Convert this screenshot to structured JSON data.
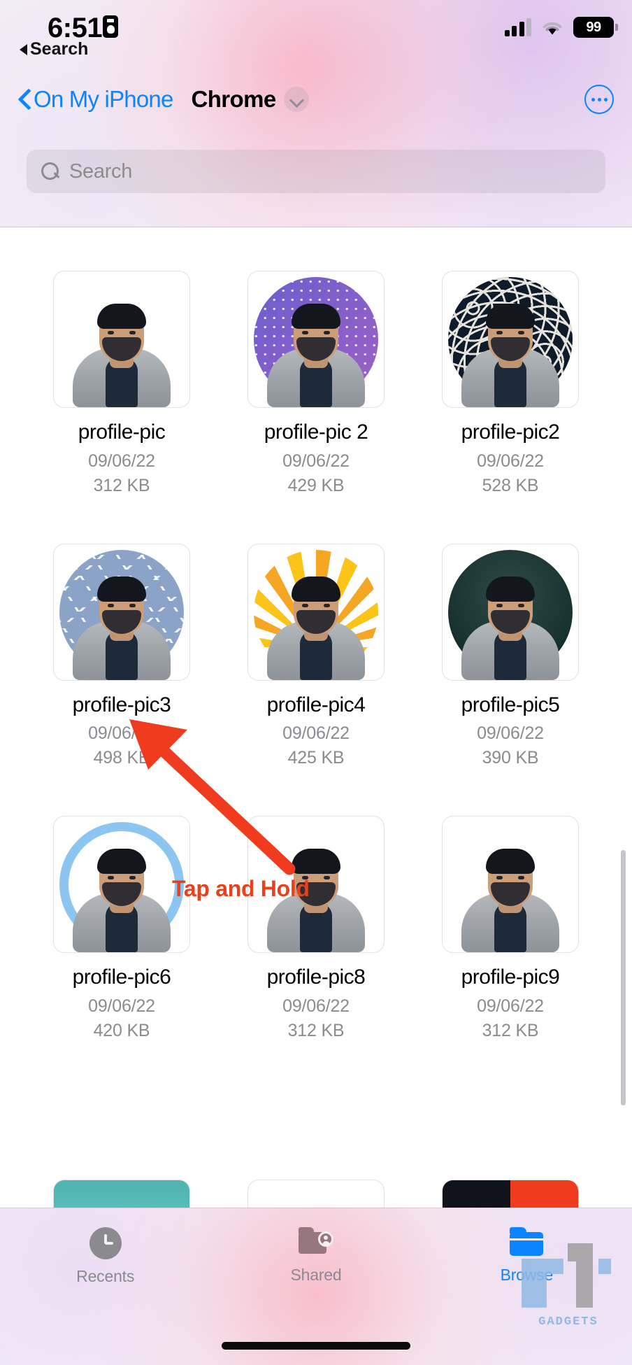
{
  "status_bar": {
    "time": "6:51",
    "recording_icon": "screen-record-icon",
    "back_label": "Search",
    "signal_icon": "cellular-signal-icon",
    "wifi_icon": "wifi-icon",
    "battery_level": "99"
  },
  "nav": {
    "back_label": "On My iPhone",
    "title": "Chrome",
    "disclosure_icon": "chevron-down-icon",
    "more_icon": "more-options-icon"
  },
  "search": {
    "placeholder": "Search",
    "value": "",
    "icon": "search-icon"
  },
  "annotation": {
    "caption": "Tap and Hold",
    "color": "#e8411c"
  },
  "files": [
    {
      "name": "profile-pic",
      "date": "09/06/22",
      "size": "312 KB",
      "art": "art-plain"
    },
    {
      "name": "profile-pic 2",
      "date": "09/06/22",
      "size": "429 KB",
      "art": "art-halftone"
    },
    {
      "name": "profile-pic2",
      "date": "09/06/22",
      "size": "528 KB",
      "art": "art-maze"
    },
    {
      "name": "profile-pic3",
      "date": "09/06/22",
      "size": "498 KB",
      "art": "art-confetti"
    },
    {
      "name": "profile-pic4",
      "date": "09/06/22",
      "size": "425 KB",
      "art": "art-sunburst"
    },
    {
      "name": "profile-pic5",
      "date": "09/06/22",
      "size": "390 KB",
      "art": "art-darkteal"
    },
    {
      "name": "profile-pic6",
      "date": "09/06/22",
      "size": "420 KB",
      "art": "art-ring"
    },
    {
      "name": "profile-pic8",
      "date": "09/06/22",
      "size": "312 KB",
      "art": "art-plain"
    },
    {
      "name": "profile-pic9",
      "date": "09/06/22",
      "size": "312 KB",
      "art": "art-plain"
    }
  ],
  "tabs": [
    {
      "label": "Recents",
      "icon": "clock-icon",
      "active": false
    },
    {
      "label": "Shared",
      "icon": "shared-folder-icon",
      "active": false
    },
    {
      "label": "Browse",
      "icon": "folder-icon",
      "active": true
    }
  ],
  "watermark": {
    "text": "GADGETS"
  },
  "colors": {
    "accent": "#0a84ff",
    "annotation": "#e8411c",
    "secondary_text": "#8b8b90"
  }
}
